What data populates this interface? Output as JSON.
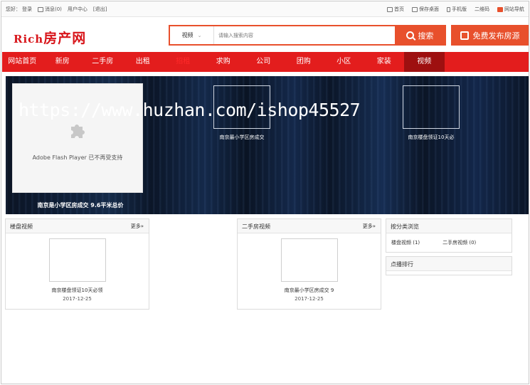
{
  "topbar": {
    "greeting": "您好：",
    "login": "登录",
    "messages": "消息(0)",
    "user_center": "用户中心",
    "logout": "[退出]",
    "home": "首页",
    "save_desktop": "保存桌面",
    "mobile": "手机版",
    "qrcode": "二维码",
    "site_nav": "网站导航"
  },
  "header": {
    "logo_prefix": "Rich",
    "logo_text": "房产网",
    "search_category": "视频",
    "search_placeholder": "请输入搜索内容",
    "search_button": "搜索",
    "publish_button": "免费发布房源"
  },
  "nav": {
    "items": [
      {
        "label": "网站首页"
      },
      {
        "label": "新房"
      },
      {
        "label": "二手房"
      },
      {
        "label": "出租"
      },
      {
        "label": "招租"
      },
      {
        "label": "求购"
      },
      {
        "label": "公司"
      },
      {
        "label": "团购"
      },
      {
        "label": "小区"
      },
      {
        "label": "家装"
      },
      {
        "label": "视频"
      }
    ],
    "active_index": 10
  },
  "banner": {
    "flash_message": "Adobe Flash Player 已不再受支持",
    "main_caption": "南京是小学区房成交 9.6平米总价",
    "thumb_captions": [
      "南京最小学区房成交",
      "南京楼盘领证10天必"
    ],
    "watermark": "https://www.huzhan.com/ishop45527"
  },
  "panels": {
    "estate_video": {
      "title": "楼盘视频",
      "more": "更多»",
      "item_title": "南京楼盘领证10天必领",
      "item_date": "2017-12-25"
    },
    "secondhand_video": {
      "title": "二手房视频",
      "more": "更多»",
      "item_title": "南京最小学区房成交 9",
      "item_date": "2017-12-25"
    },
    "category_browse": {
      "title": "按分类浏览",
      "cat1": "楼盘视频 (1)",
      "cat2": "二手房视频 (0)"
    },
    "ranking": {
      "title": "点播排行"
    }
  },
  "colors": {
    "brand_red": "#e31d1d",
    "accent_orange": "#e8502c",
    "nav_active": "#9e1010"
  }
}
